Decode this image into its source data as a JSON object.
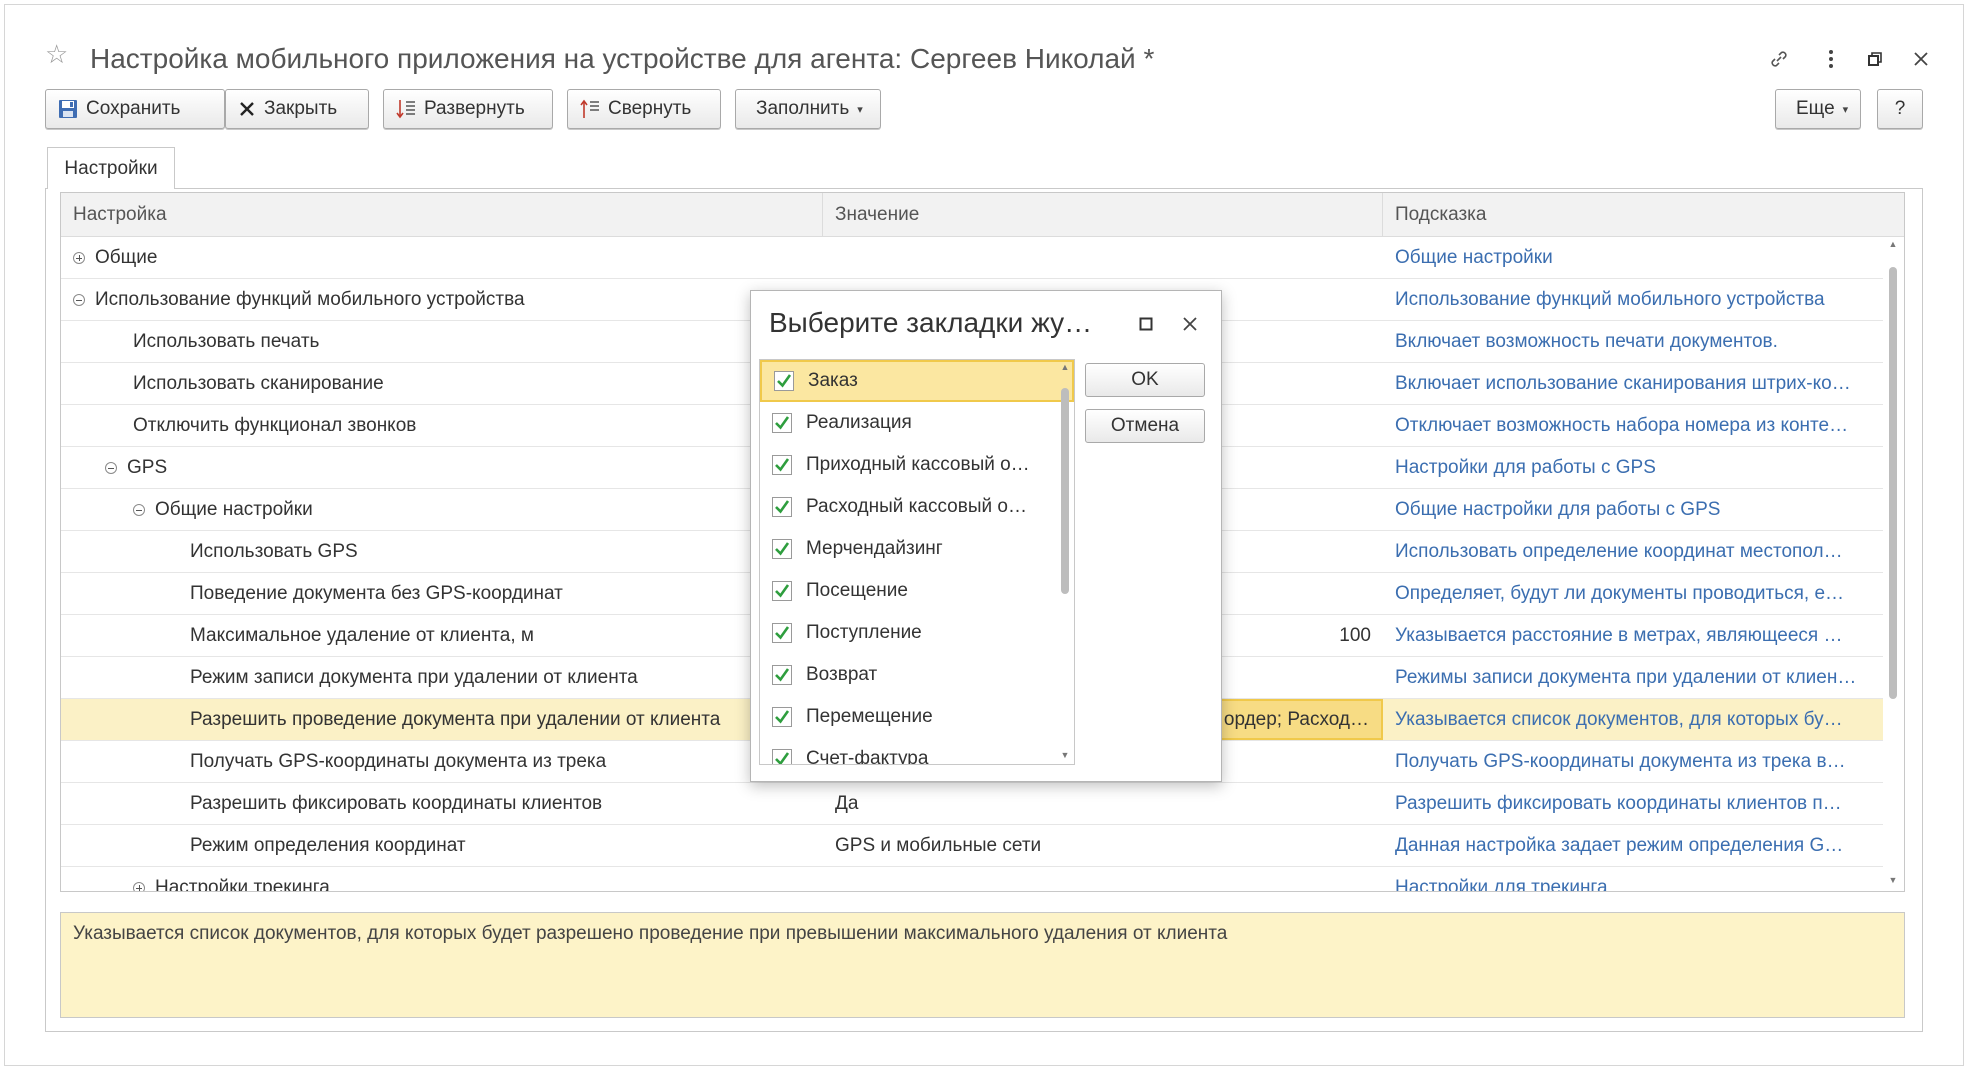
{
  "window": {
    "title": "Настройка мобильного приложения на устройстве для агента: Сергеев Николай *",
    "controls": [
      "link-icon",
      "more-icon",
      "restore-icon",
      "close-icon"
    ]
  },
  "toolbar": {
    "save_label": "Сохранить",
    "close_label": "Закрыть",
    "expand_label": "Развернуть",
    "collapse_label": "Свернуть",
    "fill_label": "Заполнить",
    "more_label": "Еще",
    "help_label": "?"
  },
  "tabs": [
    {
      "label": "Настройки"
    }
  ],
  "grid": {
    "columns": [
      "Настройка",
      "Значение",
      "Подсказка"
    ],
    "rows": [
      {
        "name": "Общие",
        "value": "",
        "hint": "Общие настройки"
      },
      {
        "name": "Использование функций мобильного устройства",
        "value": "",
        "hint": "Использование функций мобильного устройства"
      },
      {
        "name": "Использовать печать",
        "value": "",
        "hint": "Включает возможность печати документов."
      },
      {
        "name": "Использовать сканирование",
        "value": "",
        "hint": "Включает использование сканирования штрих-ко…"
      },
      {
        "name": "Отключить функционал звонков",
        "value": "",
        "hint": "Отключает возможность набора номера из конте…"
      },
      {
        "name": "GPS",
        "value": "",
        "hint": "Настройки для работы с GPS"
      },
      {
        "name": "Общие настройки",
        "value": "",
        "hint": "Общие настройки для работы с GPS"
      },
      {
        "name": "Использовать GPS",
        "value": "",
        "hint": "Использовать определение координат местопол…"
      },
      {
        "name": "Поведение документа без GPS-координат",
        "value": "",
        "hint": "Определяет, будут ли документы проводиться, е…"
      },
      {
        "name": "Максимальное удаление от клиента, м",
        "value": "100",
        "hint": "Указывается расстояние в метрах, являющееся …"
      },
      {
        "name": "Режим записи документа при удалении от клиента",
        "value": "",
        "hint": "Режимы записи документа при удалении от клиен…"
      },
      {
        "name": "Разрешить проведение документа при удалении от клиента",
        "value": "ордер; Расход…",
        "hint": "Указывается список документов, для которых бу…"
      },
      {
        "name": "Получать GPS-координаты документа из трека",
        "value": "",
        "hint": "Получать GPS-координаты документа из трека в…"
      },
      {
        "name": "Разрешить фиксировать координаты клиентов",
        "value": "Да",
        "hint": "Разрешить фиксировать координаты клиентов п…"
      },
      {
        "name": "Режим определения координат",
        "value": "GPS и мобильные сети",
        "hint": "Данная настройка задает режим определения G…"
      },
      {
        "name": "Настройки трекинга",
        "value": "",
        "hint": "Настройки для трекинга"
      }
    ]
  },
  "description": "Указывается список документов, для которых будет разрешено проведение при превышении максимального удаления от клиента",
  "dialog": {
    "title": "Выберите закладки жу…",
    "ok_label": "OK",
    "cancel_label": "Отмена",
    "items": [
      {
        "label": "Заказ",
        "checked": true
      },
      {
        "label": "Реализация",
        "checked": true
      },
      {
        "label": "Приходный кассовый о…",
        "checked": true
      },
      {
        "label": "Расходный кассовый о…",
        "checked": true
      },
      {
        "label": "Мерчендайзинг",
        "checked": true
      },
      {
        "label": "Посещение",
        "checked": true
      },
      {
        "label": "Поступление",
        "checked": true
      },
      {
        "label": "Возврат",
        "checked": true
      },
      {
        "label": "Перемещение",
        "checked": true
      },
      {
        "label": "Счет-фактура",
        "checked": true
      }
    ]
  },
  "colors": {
    "link": "#3b6eb0",
    "selected_row": "#fbf1c6",
    "selected_cell": "#f7dc84",
    "accent_border": "#f0c94b",
    "checkmark": "#2e9e3e"
  }
}
